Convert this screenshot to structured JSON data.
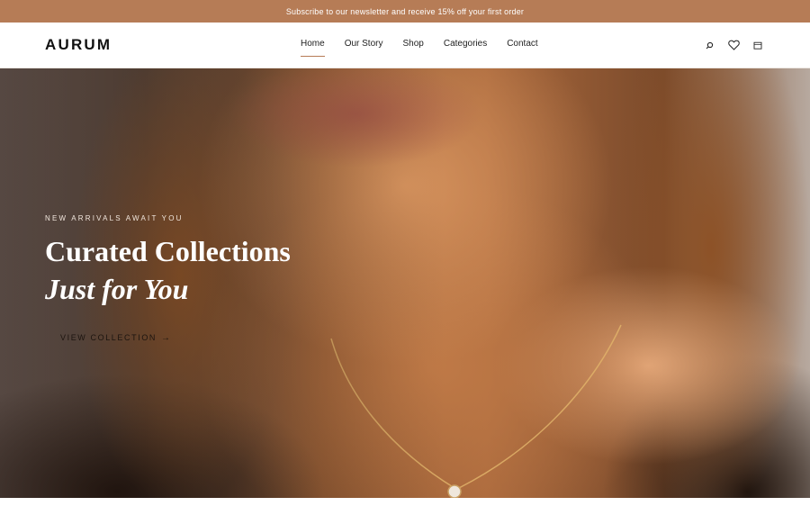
{
  "announcement": {
    "text": "Subscribe to our newsletter and receive 15% off your first order"
  },
  "header": {
    "logo": "AURUM",
    "nav": [
      {
        "label": "Home",
        "active": true
      },
      {
        "label": "Our Story",
        "active": false
      },
      {
        "label": "Shop",
        "active": false
      },
      {
        "label": "Categories",
        "active": false
      },
      {
        "label": "Contact",
        "active": false
      }
    ],
    "icons": [
      "search-icon",
      "heart-icon",
      "bag-icon"
    ]
  },
  "hero": {
    "eyebrow": "NEW ARRIVALS AWAIT YOU",
    "title_line1": "Curated Collections",
    "title_line2": "Just for You",
    "cta_label": "VIEW COLLECTION",
    "cta_arrow": "→"
  },
  "colors": {
    "announcement_bg": "#b67c56",
    "accent": "#b67c56",
    "text": "#1a1a1a",
    "hero_text": "#ffffff"
  }
}
